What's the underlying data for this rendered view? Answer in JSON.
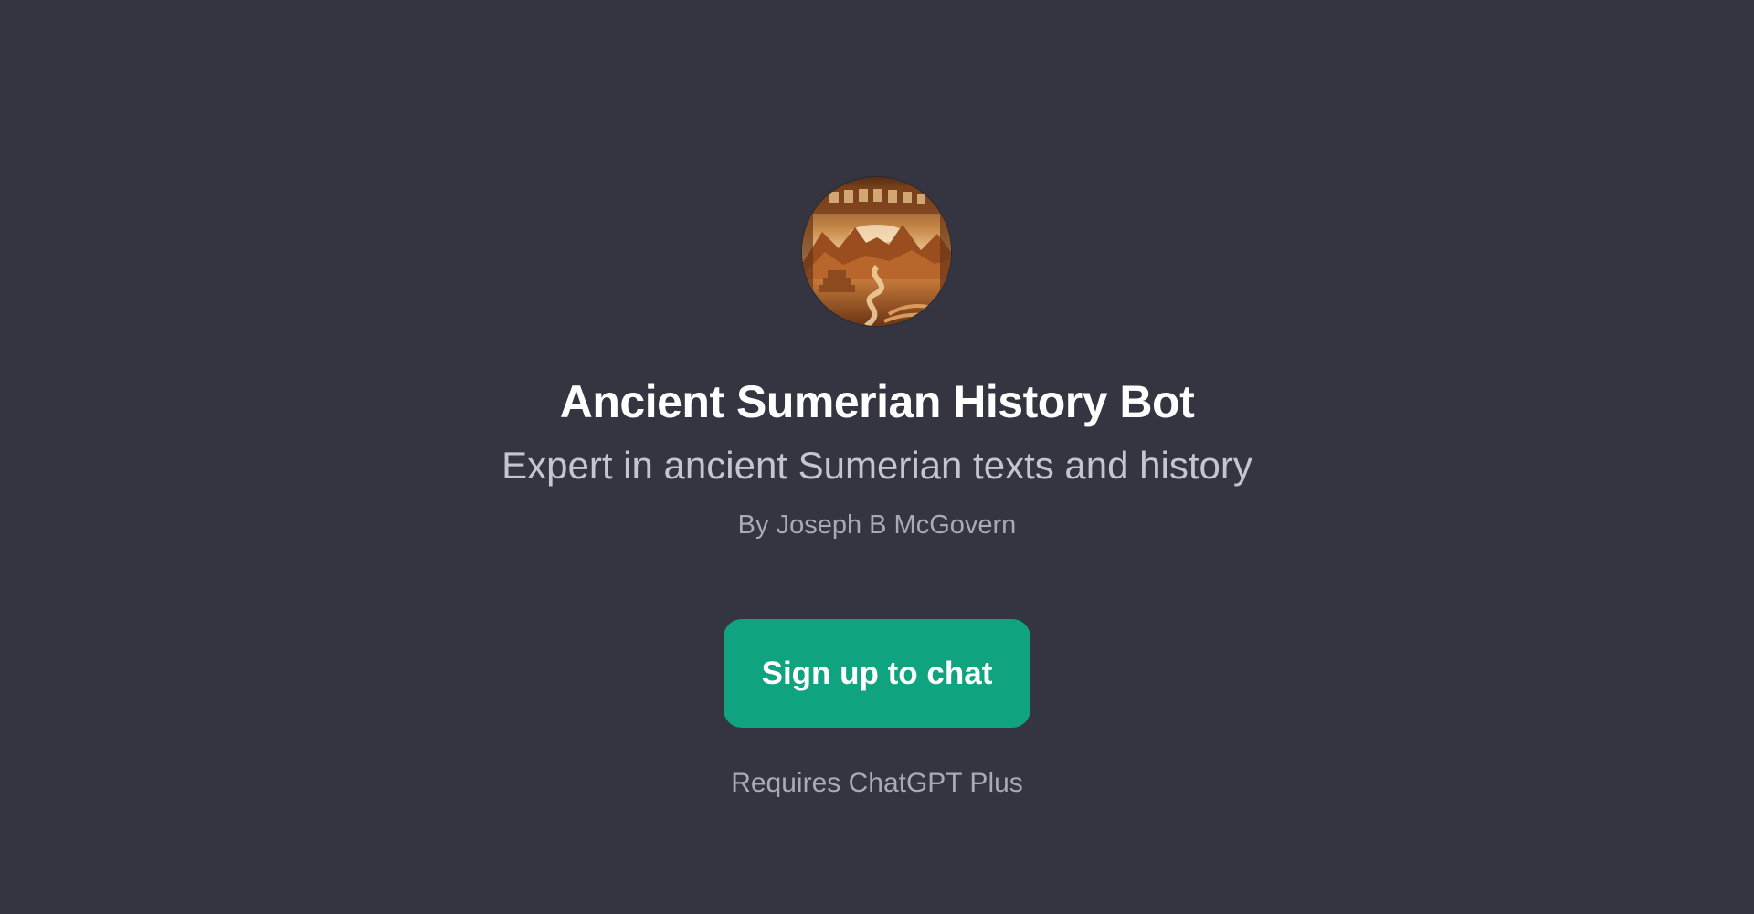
{
  "gpt": {
    "title": "Ancient Sumerian History Bot",
    "description": "Expert in ancient Sumerian texts and history",
    "author": "By Joseph B McGovern",
    "avatar_icon": "sumerian-landscape-avatar"
  },
  "actions": {
    "signup_label": "Sign up to chat",
    "requirement_note": "Requires ChatGPT Plus"
  },
  "colors": {
    "background": "#343541",
    "accent": "#10a37f",
    "title": "#ffffff",
    "subtitle": "#c5c5d2",
    "muted": "#a9a9b7"
  }
}
